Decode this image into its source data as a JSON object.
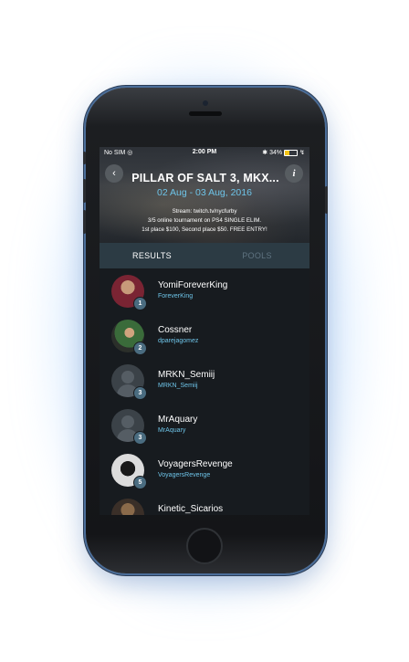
{
  "status_bar": {
    "carrier": "No SIM",
    "time": "2:00 PM",
    "battery_percent": "34%",
    "battery_level": 0.34
  },
  "event": {
    "title": "PILLAR OF SALT 3, MKX...",
    "dates": "02 Aug - 03 Aug, 2016",
    "description_lines": [
      "Stream: twitch.tv/nycfurby",
      "3/5 online tournament on PS4 SINGLE ELIM.",
      "1st place $100, Second place $50. FREE ENTRY!"
    ],
    "back_icon": "chevron-left-icon",
    "info_icon": "info-icon",
    "back_glyph": "‹",
    "info_glyph": "i"
  },
  "tabs": [
    {
      "label": "RESULTS",
      "active": true
    },
    {
      "label": "POOLS",
      "active": false
    }
  ],
  "results": [
    {
      "rank": "1",
      "name": "YomiForeverKing",
      "handle": "ForeverKing",
      "avatar": "photo1"
    },
    {
      "rank": "2",
      "name": "Cossner",
      "handle": "dparejagomez",
      "avatar": "photo2"
    },
    {
      "rank": "3",
      "name": "MRKN_Semiij",
      "handle": "MRKN_Semiij",
      "avatar": "default"
    },
    {
      "rank": "3",
      "name": "MrAquary",
      "handle": "MrAquary",
      "avatar": "default"
    },
    {
      "rank": "5",
      "name": "VoyagersRevenge",
      "handle": "VoyagersRevenge",
      "avatar": "photo5"
    },
    {
      "rank": "",
      "name": "Kinetic_Sicarios",
      "handle": "",
      "avatar": "photo6"
    }
  ],
  "colors": {
    "accent": "#6ec4e8",
    "tab_bar": "#2c3b44",
    "background": "#171b1f"
  }
}
